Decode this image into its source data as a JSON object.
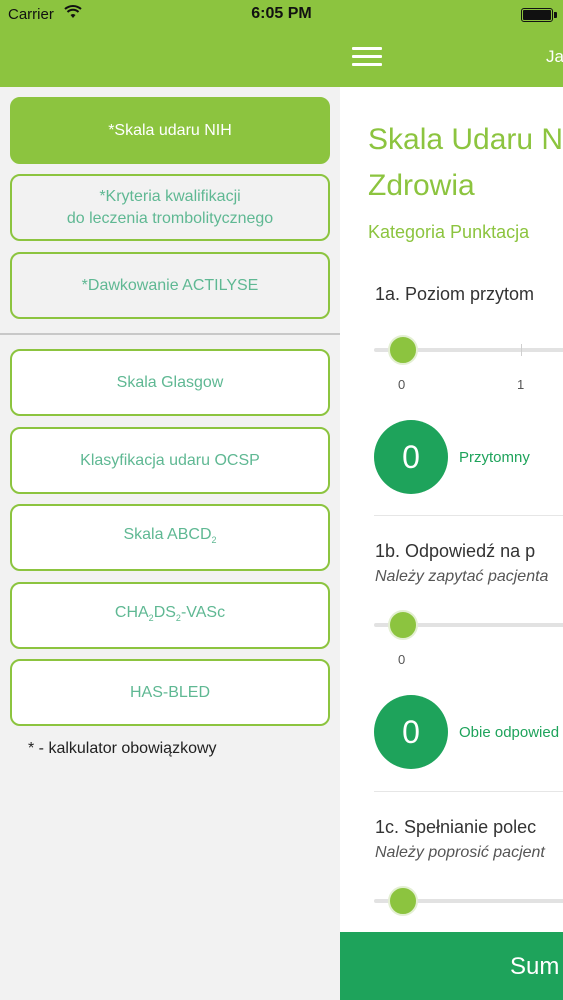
{
  "status": {
    "carrier": "Carrier",
    "time": "6:05 PM"
  },
  "nav": {
    "right_text": "Ja"
  },
  "sidebar": {
    "items": [
      {
        "label": "*Skala udaru NIH"
      },
      {
        "line1": "*Kryteria kwalifikacji",
        "line2": "do leczenia trombolitycznego"
      },
      {
        "label": "*Dawkowanie ACTILYSE"
      },
      {
        "label": "Skala Glasgow"
      },
      {
        "label": "Klasyfikacja udaru OCSP"
      },
      {
        "label": "Skala ABCD",
        "sub1": "2"
      },
      {
        "p1": "CHA",
        "sub1": "2",
        "p2": "DS",
        "sub2": "2",
        "p3": "-VASc"
      },
      {
        "label": "HAS-BLED"
      }
    ],
    "footnote": "* - kalkulator obowiązkowy"
  },
  "content": {
    "title_line1": "Skala Udaru N",
    "title_line2": "Zdrowia",
    "category": "Kategoria Punktacja",
    "questions": [
      {
        "title": "1a. Poziom przytom",
        "subtitle": "",
        "ticks": [
          "0",
          "1"
        ],
        "score": "0",
        "score_label": "Przytomny"
      },
      {
        "title": "1b. Odpowiedź na p",
        "subtitle": "Należy zapytać pacjenta",
        "ticks": [
          "0"
        ],
        "score": "0",
        "score_label": "Obie odpowied"
      },
      {
        "title": "1c. Spełnianie polec",
        "subtitle": "Należy poprosić pacjent",
        "ticks": [],
        "score": "",
        "score_label": ""
      }
    ],
    "bottom_button": "Sum"
  },
  "colors": {
    "accent": "#8cc43f",
    "score_green": "#1ea35b",
    "menu_text": "#5fb893"
  }
}
